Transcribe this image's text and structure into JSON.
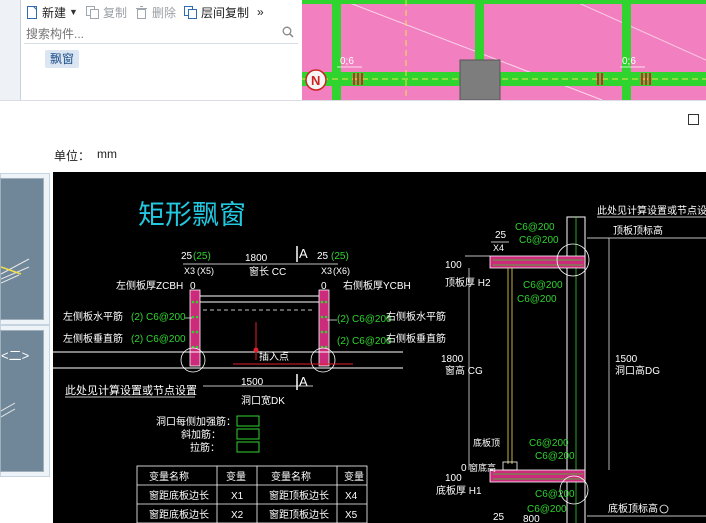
{
  "toolbar": {
    "new_label": "新建",
    "copy_label": "复制",
    "delete_label": "删除",
    "layer_copy_label": "层间复制",
    "more_label": "»"
  },
  "search": {
    "placeholder": "搜索构件..."
  },
  "component_list": {
    "selected_item": "飘窗"
  },
  "plan_view": {
    "beam_label_1": "0;6",
    "beam_label_2": "0;6",
    "axis_marker": "N"
  },
  "unit": {
    "label": "单位：",
    "value": "mm"
  },
  "thumbnails": {
    "item2_label": "<二>"
  },
  "drawing": {
    "title": "矩形飘窗",
    "left_bracket_25": "25",
    "left_bracket_x5": "(25)",
    "dim_1800_top": "1800",
    "right_bracket_25": "25",
    "right_bracket_x6": "(25)",
    "sec_mark_top": "A",
    "x3_label": "X3",
    "x5_label": "(X5)",
    "window_len_label": "窗长 CC",
    "x3b_label": "X3",
    "x6_label": "(X6)",
    "zero_left": "0",
    "zero_right": "0",
    "left_thick_label": "左侧板厚ZCBH",
    "right_thick_label": "右侧板厚YCBH",
    "left_horiz_bar_label": "左侧板水平筋",
    "left_horiz_bar_value": "(2) C6@200",
    "right_horiz_bar_value": "(2) C6@200",
    "right_horiz_bar_label": "右侧板水平筋",
    "left_vert_bar_label": "左侧板垂直筋",
    "left_vert_bar_value": "(2) C6@200",
    "right_vert_bar_value": "(2) C6@200",
    "right_vert_bar_label": "右侧板垂直筋",
    "insert_point_label": "插入点",
    "dim_1500_bottom": "1500",
    "sec_mark_bottom": "A",
    "opening_width_label": "洞口宽DK",
    "see_calc_left": "此处见计算设置或节点设置",
    "opening_add_bar": "洞口每侧加强筋：",
    "slant_bar": "斜加筋：",
    "tie_bar": "拉筋：",
    "see_calc_right": "此处见计算设置或节点设置",
    "top_slab_elev": "顶板顶标高",
    "dim_25_right": "25",
    "x4_label": "X4",
    "c6_top_1": "C6@200",
    "c6_top_2": "C6@200",
    "c6_top_3": "C6@200",
    "c6_top_4": "C6@200",
    "dim_100_top": "100",
    "top_slab_thick": "顶板厚 H2",
    "dim_1800_right": "1800",
    "window_height": "窗高 CG",
    "dim_1500_right": "1500",
    "opening_height": "洞口高DG",
    "bottom_slab_top_label": "底板顶",
    "c6_bot_1": "C6@200",
    "c6_bot_2": "C6@200",
    "dim_0": "0",
    "bottom_elev_label": "窗底高",
    "dim_100_bottom": "100",
    "bottom_slab_thick": "底板厚 H1",
    "c6_bot_3": "C6@200",
    "c6_bot_4": "C6@200",
    "bottom_slab_elev": "底板顶标高",
    "dim_25_bottom": "25",
    "dim_800_bottom": "800"
  },
  "var_table": {
    "headers": [
      "变量名称",
      "变量",
      "变量名称",
      "变量"
    ],
    "rows": [
      [
        "窗距底板边长",
        "X1",
        "窗距顶板边长",
        "X4"
      ],
      [
        "窗距底板边长",
        "X2",
        "窗距顶板边长",
        "X5"
      ]
    ]
  },
  "colors": {
    "cad_bg": "#000000",
    "plan_bg": "#f27fc0",
    "plan_beam": "#2fd42f",
    "title_cyan": "#22c7e0",
    "dim_text": "#ffffff",
    "bar_green": "#2fd42f",
    "slab_magenta": "#cc2a7a"
  }
}
